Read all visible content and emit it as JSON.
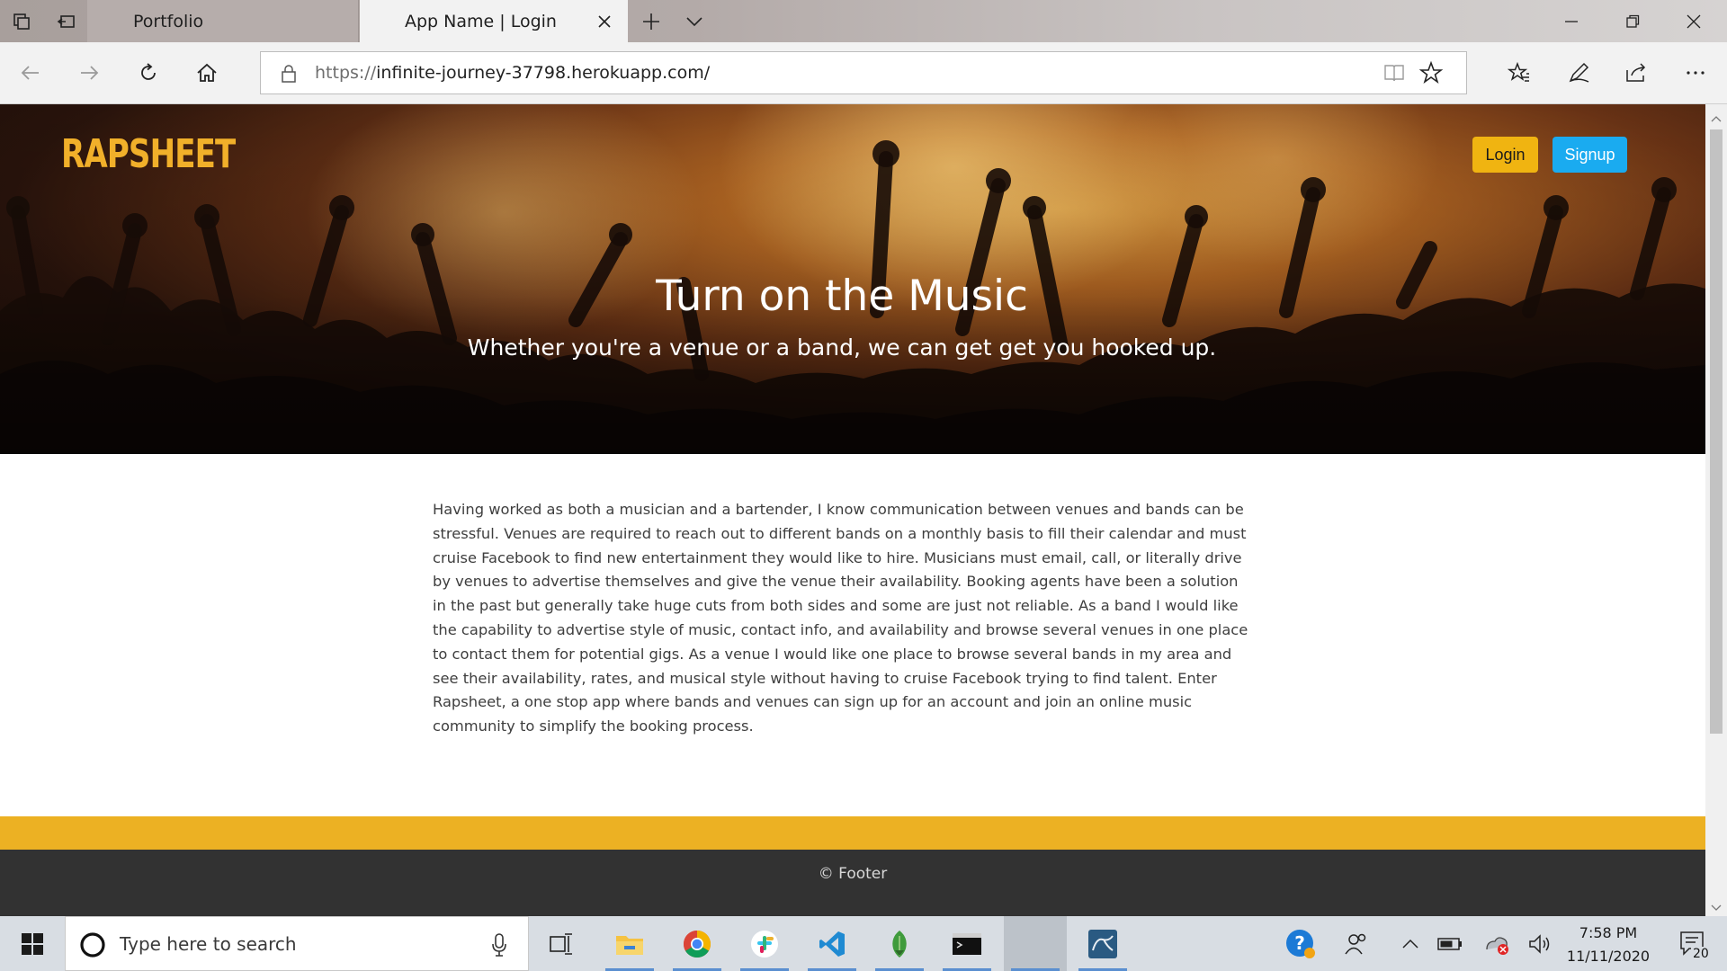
{
  "browser": {
    "tabs": [
      {
        "label": "Portfolio",
        "active": false
      },
      {
        "label": "App Name | Login",
        "active": true
      }
    ],
    "address": {
      "scheme": "https://",
      "host_path": "infinite-journey-37798.herokuapp.com/"
    }
  },
  "page": {
    "logo": "RAPSHEET",
    "login_label": "Login",
    "signup_label": "Signup",
    "hero_title": "Turn on the Music",
    "hero_subtitle": "Whether you're a venue or a band, we can get get you hooked up.",
    "about": "Having worked as both a musician and a bartender, I know communication between venues and bands can be stressful. Venues are required to reach out to different bands on a monthly basis to fill their calendar and must cruise Facebook to find new entertainment they would like to hire. Musicians must email, call, or literally drive by venues to advertise themselves and give the venue their availability. Booking agents have been a solution in the past but generally take huge cuts from both sides and some are just not reliable. As a band I would like the capability to advertise style of music, contact info, and availability and browse several venues in one place to contact them for potential gigs. As a venue I would like one place to browse several bands in my area and see their availability, rates, and musical style without having to cruise Facebook trying to find talent. Enter Rapsheet, a one stop app where bands and venues can sign up for an account and join an online music community to simplify the booking process.",
    "footer": "© Footer",
    "colors": {
      "accent_yellow": "#f0b411",
      "signup_blue": "#1aabf0",
      "footer_stripe": "#ecb123",
      "footer_bg": "#323232"
    }
  },
  "taskbar": {
    "search_placeholder": "Type here to search",
    "apps": [
      "task-view-icon",
      "file-explorer-icon",
      "chrome-icon",
      "slack-icon",
      "vscode-icon",
      "mongodb-compass-icon",
      "terminal-icon",
      "blank-app-icon",
      "mysql-workbench-icon"
    ],
    "clock_time": "7:58 PM",
    "clock_date": "11/11/2020",
    "notification_count": "20"
  }
}
